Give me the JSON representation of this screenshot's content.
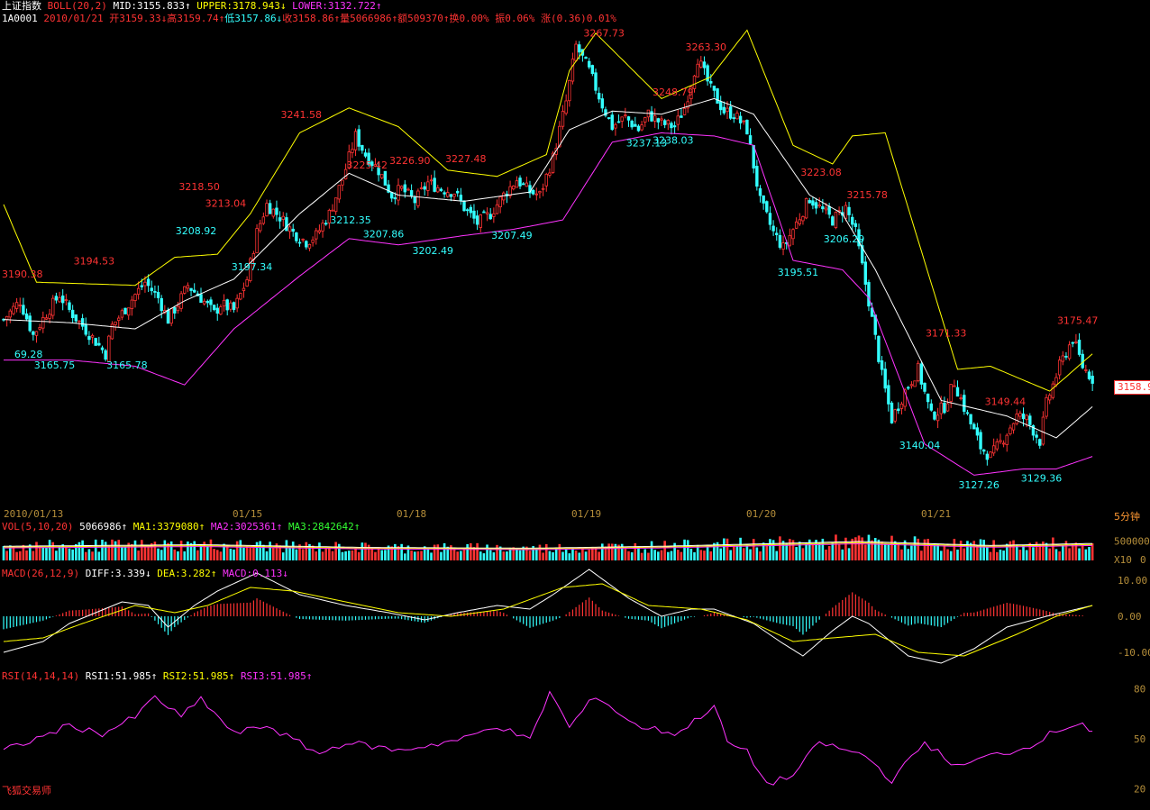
{
  "header": {
    "index_name": "上证指数",
    "boll": {
      "label": "BOLL(20,2)",
      "mid": "MID:3155.833↑",
      "upper": "UPPER:3178.943↓",
      "lower": "LOWER:3132.722↑"
    },
    "code": "1A0001",
    "date": "2010/01/21",
    "open": "开3159.33↓",
    "high": "高3159.74↑",
    "low": "低3157.86↓",
    "close": "收3158.86↑",
    "volume": "量5066986↑",
    "amount": "额509370↑",
    "turnover": "换0.00%",
    "amplitude": "振0.06%",
    "change": "涨(0.36)0.01%"
  },
  "current_price_tag": "3158.9",
  "period_label": "5分钟",
  "brand": "飞狐交易师",
  "colors": {
    "up": "#ff3333",
    "down": "#33ffff",
    "upper": "#ffff00",
    "mid": "#ffffff",
    "lower": "#ff33ff",
    "background": "#000000"
  },
  "chart_data": [
    {
      "type": "candlestick",
      "title": "上证指数 BOLL(20,2)",
      "x_dates": [
        "2010/01/13",
        "01/15",
        "01/18",
        "01/19",
        "01/20",
        "01/21"
      ],
      "ylim": [
        3120,
        3272
      ],
      "annotations": [
        {
          "text": "3190.38",
          "value": 3190.38,
          "kind": "high"
        },
        {
          "text": "3194.53",
          "value": 3194.53,
          "kind": "high"
        },
        {
          "text": "69.28",
          "value": 3169.28,
          "kind": "low"
        },
        {
          "text": "3165.75",
          "value": 3165.75,
          "kind": "low"
        },
        {
          "text": "3165.78",
          "value": 3165.78,
          "kind": "low"
        },
        {
          "text": "3218.50",
          "value": 3218.5,
          "kind": "high"
        },
        {
          "text": "3213.04",
          "value": 3213.04,
          "kind": "high"
        },
        {
          "text": "3208.92",
          "value": 3208.92,
          "kind": "low"
        },
        {
          "text": "3197.34",
          "value": 3197.34,
          "kind": "low"
        },
        {
          "text": "3241.58",
          "value": 3241.58,
          "kind": "high"
        },
        {
          "text": "3225.42",
          "value": 3225.42,
          "kind": "high"
        },
        {
          "text": "3226.90",
          "value": 3226.9,
          "kind": "high"
        },
        {
          "text": "3212.35",
          "value": 3212.35,
          "kind": "low"
        },
        {
          "text": "3207.86",
          "value": 3207.86,
          "kind": "low"
        },
        {
          "text": "3202.49",
          "value": 3202.49,
          "kind": "low"
        },
        {
          "text": "3227.48",
          "value": 3227.48,
          "kind": "high"
        },
        {
          "text": "3207.49",
          "value": 3207.49,
          "kind": "low"
        },
        {
          "text": "3267.73",
          "value": 3267.73,
          "kind": "high"
        },
        {
          "text": "3248.79",
          "value": 3248.79,
          "kind": "high"
        },
        {
          "text": "3237.13",
          "value": 3237.13,
          "kind": "low"
        },
        {
          "text": "3238.03",
          "value": 3238.03,
          "kind": "low"
        },
        {
          "text": "3263.30",
          "value": 3263.3,
          "kind": "high"
        },
        {
          "text": "3223.08",
          "value": 3223.08,
          "kind": "high"
        },
        {
          "text": "3215.78",
          "value": 3215.78,
          "kind": "high"
        },
        {
          "text": "3206.29",
          "value": 3206.29,
          "kind": "low"
        },
        {
          "text": "3195.51",
          "value": 3195.51,
          "kind": "low"
        },
        {
          "text": "3171.33",
          "value": 3171.33,
          "kind": "high"
        },
        {
          "text": "3140.04",
          "value": 3140.04,
          "kind": "low"
        },
        {
          "text": "3149.44",
          "value": 3149.44,
          "kind": "high"
        },
        {
          "text": "3127.26",
          "value": 3127.26,
          "kind": "low"
        },
        {
          "text": "3129.36",
          "value": 3129.36,
          "kind": "low"
        },
        {
          "text": "3175.47",
          "value": 3175.47,
          "kind": "high"
        }
      ],
      "close_path": [
        [
          0,
          3178
        ],
        [
          5,
          3184
        ],
        [
          9,
          3173
        ],
        [
          13,
          3180
        ],
        [
          17,
          3186
        ],
        [
          20,
          3181
        ],
        [
          24,
          3176
        ],
        [
          28,
          3171
        ],
        [
          31,
          3167
        ],
        [
          33,
          3176
        ],
        [
          36,
          3180
        ],
        [
          40,
          3186
        ],
        [
          43,
          3190
        ],
        [
          47,
          3185
        ],
        [
          50,
          3178
        ],
        [
          53,
          3183
        ],
        [
          56,
          3189
        ],
        [
          60,
          3185
        ],
        [
          64,
          3180
        ],
        [
          66,
          3183
        ],
        [
          70,
          3181
        ],
        [
          74,
          3191
        ],
        [
          77,
          3206
        ],
        [
          80,
          3215
        ],
        [
          84,
          3211
        ],
        [
          88,
          3206
        ],
        [
          92,
          3203
        ],
        [
          95,
          3205
        ],
        [
          99,
          3212
        ],
        [
          103,
          3223
        ],
        [
          107,
          3237
        ],
        [
          110,
          3231
        ],
        [
          114,
          3226
        ],
        [
          118,
          3218
        ],
        [
          121,
          3220
        ],
        [
          125,
          3216
        ],
        [
          129,
          3222
        ],
        [
          133,
          3220
        ],
        [
          137,
          3219
        ],
        [
          140,
          3214
        ],
        [
          144,
          3209
        ],
        [
          148,
          3212
        ],
        [
          152,
          3218
        ],
        [
          156,
          3223
        ],
        [
          160,
          3219
        ],
        [
          163,
          3218
        ],
        [
          167,
          3230
        ],
        [
          171,
          3248
        ],
        [
          174,
          3266
        ],
        [
          178,
          3258
        ],
        [
          182,
          3247
        ],
        [
          185,
          3240
        ],
        [
          189,
          3243
        ],
        [
          193,
          3239
        ],
        [
          196,
          3244
        ],
        [
          200,
          3241
        ],
        [
          204,
          3240
        ],
        [
          207,
          3246
        ],
        [
          211,
          3262
        ],
        [
          215,
          3252
        ],
        [
          219,
          3245
        ],
        [
          222,
          3244
        ],
        [
          226,
          3239
        ],
        [
          230,
          3216
        ],
        [
          234,
          3206
        ],
        [
          237,
          3201
        ],
        [
          241,
          3209
        ],
        [
          245,
          3217
        ],
        [
          248,
          3214
        ],
        [
          252,
          3210
        ],
        [
          256,
          3214
        ],
        [
          259,
          3206
        ],
        [
          263,
          3184
        ],
        [
          267,
          3160
        ],
        [
          270,
          3146
        ],
        [
          274,
          3155
        ],
        [
          278,
          3162
        ],
        [
          282,
          3147
        ],
        [
          286,
          3150
        ],
        [
          289,
          3158
        ],
        [
          293,
          3147
        ],
        [
          297,
          3137
        ],
        [
          300,
          3134
        ],
        [
          304,
          3140
        ],
        [
          308,
          3147
        ],
        [
          311,
          3146
        ],
        [
          315,
          3139
        ],
        [
          317,
          3151
        ],
        [
          321,
          3163
        ],
        [
          325,
          3172
        ],
        [
          328,
          3163
        ],
        [
          331,
          3159
        ]
      ],
      "boll_upper": [
        [
          0,
          3215
        ],
        [
          10,
          3190
        ],
        [
          40,
          3189
        ],
        [
          52,
          3198
        ],
        [
          65,
          3199
        ],
        [
          75,
          3212
        ],
        [
          90,
          3238
        ],
        [
          105,
          3246
        ],
        [
          120,
          3240
        ],
        [
          135,
          3226
        ],
        [
          150,
          3224
        ],
        [
          165,
          3231
        ],
        [
          172,
          3258
        ],
        [
          180,
          3270
        ],
        [
          200,
          3249
        ],
        [
          215,
          3256
        ],
        [
          226,
          3271
        ],
        [
          240,
          3234
        ],
        [
          252,
          3228
        ],
        [
          258,
          3237
        ],
        [
          268,
          3238
        ],
        [
          290,
          3162
        ],
        [
          300,
          3163
        ],
        [
          318,
          3155
        ],
        [
          331,
          3167
        ]
      ],
      "boll_mid": [
        [
          0,
          3178
        ],
        [
          20,
          3177
        ],
        [
          40,
          3175
        ],
        [
          55,
          3184
        ],
        [
          70,
          3191
        ],
        [
          90,
          3212
        ],
        [
          105,
          3225
        ],
        [
          120,
          3218
        ],
        [
          140,
          3216
        ],
        [
          160,
          3219
        ],
        [
          172,
          3239
        ],
        [
          185,
          3245
        ],
        [
          200,
          3244
        ],
        [
          216,
          3249
        ],
        [
          228,
          3244
        ],
        [
          245,
          3218
        ],
        [
          255,
          3212
        ],
        [
          265,
          3194
        ],
        [
          285,
          3152
        ],
        [
          305,
          3147
        ],
        [
          320,
          3140
        ],
        [
          331,
          3150
        ]
      ],
      "boll_lower": [
        [
          0,
          3165
        ],
        [
          20,
          3165
        ],
        [
          40,
          3163
        ],
        [
          55,
          3157
        ],
        [
          70,
          3175
        ],
        [
          90,
          3192
        ],
        [
          105,
          3204
        ],
        [
          120,
          3202
        ],
        [
          140,
          3205
        ],
        [
          155,
          3207
        ],
        [
          170,
          3210
        ],
        [
          185,
          3235
        ],
        [
          200,
          3238
        ],
        [
          216,
          3237
        ],
        [
          228,
          3234
        ],
        [
          240,
          3197
        ],
        [
          255,
          3194
        ],
        [
          263,
          3185
        ],
        [
          280,
          3138
        ],
        [
          295,
          3128
        ],
        [
          310,
          3130
        ],
        [
          320,
          3130
        ],
        [
          331,
          3134
        ]
      ]
    },
    {
      "type": "bar",
      "title": "VOL(5,10,20)",
      "series_labels": [
        "5066986↑",
        "MA1:3379080↑",
        "MA2:3025361↑",
        "MA3:2842642↑"
      ],
      "y_ticks": [
        "500000",
        "0"
      ],
      "unit_label": "X10",
      "ylim": [
        0,
        700000
      ],
      "profile": [
        [
          0,
          360000
        ],
        [
          60,
          400000
        ],
        [
          110,
          330000
        ],
        [
          160,
          310000
        ],
        [
          200,
          360000
        ],
        [
          260,
          480000
        ],
        [
          300,
          380000
        ],
        [
          331,
          430000
        ]
      ]
    },
    {
      "type": "bar",
      "title": "MACD(26,12,9)",
      "series_labels": [
        "DIFF:3.339↓",
        "DEA:3.282↑",
        "MACD:0.113↓"
      ],
      "y_ticks": [
        "10.00",
        "0.00",
        "-10.00"
      ],
      "ylim": [
        -14,
        11
      ],
      "diff": [
        [
          0,
          -10
        ],
        [
          12,
          -7
        ],
        [
          20,
          -2
        ],
        [
          36,
          4
        ],
        [
          44,
          3
        ],
        [
          50,
          -3
        ],
        [
          58,
          3
        ],
        [
          65,
          7
        ],
        [
          77,
          12
        ],
        [
          90,
          6
        ],
        [
          104,
          3
        ],
        [
          117,
          1
        ],
        [
          128,
          -1
        ],
        [
          138,
          1
        ],
        [
          150,
          3
        ],
        [
          160,
          2
        ],
        [
          167,
          6
        ],
        [
          178,
          13
        ],
        [
          190,
          5
        ],
        [
          200,
          0
        ],
        [
          209,
          2
        ],
        [
          216,
          2
        ],
        [
          228,
          -2
        ],
        [
          236,
          -7
        ],
        [
          243,
          -11
        ],
        [
          252,
          -4
        ],
        [
          258,
          0
        ],
        [
          263,
          -2
        ],
        [
          275,
          -11
        ],
        [
          285,
          -13
        ],
        [
          295,
          -9
        ],
        [
          305,
          -3
        ],
        [
          317,
          0
        ],
        [
          331,
          3
        ]
      ],
      "dea": [
        [
          0,
          -7
        ],
        [
          12,
          -6
        ],
        [
          24,
          -2
        ],
        [
          40,
          3
        ],
        [
          52,
          1
        ],
        [
          62,
          3
        ],
        [
          75,
          8
        ],
        [
          88,
          7
        ],
        [
          104,
          4
        ],
        [
          120,
          1
        ],
        [
          136,
          0
        ],
        [
          152,
          2
        ],
        [
          170,
          8
        ],
        [
          182,
          9
        ],
        [
          196,
          3
        ],
        [
          212,
          2
        ],
        [
          226,
          -1
        ],
        [
          240,
          -7
        ],
        [
          252,
          -6
        ],
        [
          265,
          -5
        ],
        [
          278,
          -10
        ],
        [
          292,
          -11
        ],
        [
          308,
          -5
        ],
        [
          320,
          0
        ],
        [
          331,
          3
        ]
      ]
    },
    {
      "type": "line",
      "title": "RSI(14,14,14)",
      "series_labels": [
        "RSI1:51.985↑",
        "RSI2:51.985↑",
        "RSI3:51.985↑"
      ],
      "y_ticks": [
        "80",
        "50",
        "20"
      ],
      "ylim": [
        15,
        85
      ],
      "rsi": [
        [
          0,
          43
        ],
        [
          10,
          50
        ],
        [
          20,
          58
        ],
        [
          30,
          53
        ],
        [
          40,
          63
        ],
        [
          46,
          75
        ],
        [
          54,
          63
        ],
        [
          60,
          74
        ],
        [
          70,
          53
        ],
        [
          80,
          58
        ],
        [
          96,
          41
        ],
        [
          104,
          48
        ],
        [
          120,
          43
        ],
        [
          140,
          50
        ],
        [
          150,
          58
        ],
        [
          160,
          49
        ],
        [
          166,
          78
        ],
        [
          172,
          57
        ],
        [
          180,
          76
        ],
        [
          192,
          58
        ],
        [
          205,
          53
        ],
        [
          216,
          70
        ],
        [
          220,
          48
        ],
        [
          226,
          42
        ],
        [
          232,
          23
        ],
        [
          240,
          28
        ],
        [
          248,
          48
        ],
        [
          256,
          43
        ],
        [
          262,
          40
        ],
        [
          270,
          25
        ],
        [
          280,
          48
        ],
        [
          290,
          33
        ],
        [
          300,
          40
        ],
        [
          310,
          44
        ],
        [
          320,
          55
        ],
        [
          328,
          60
        ],
        [
          331,
          52
        ]
      ]
    }
  ]
}
